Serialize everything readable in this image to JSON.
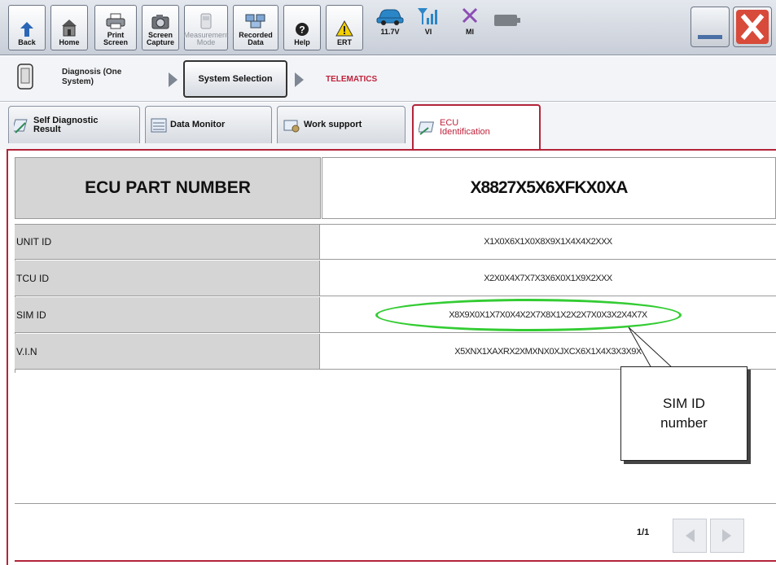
{
  "toolbar": {
    "back": "Back",
    "home": "Home",
    "print_screen": "Print Screen",
    "screen_capture": "Screen\nCapture",
    "measurement_mode": "Measurement\nMode",
    "recorded_data": "Recorded\nData",
    "help": "Help",
    "ert": "ERT",
    "battery_voltage": "11.7V",
    "vi": "VI",
    "mi": "MI"
  },
  "breadcrumb": {
    "diagnosis": "Diagnosis (One\nSystem)",
    "system_selection": "System Selection",
    "current": "TELEMATICS"
  },
  "tabs": {
    "self_diagnostic": "Self Diagnostic\nResult",
    "data_monitor": "Data Monitor",
    "work_support": "Work support",
    "ecu_identification": "ECU\nIdentification"
  },
  "table": {
    "header_label": "ECU PART NUMBER",
    "header_value": "X8827X5X6XFKX0XA",
    "rows": [
      {
        "label": "UNIT ID",
        "value": "X1X0X6X1X0X8X9X1X4X4X2XXX"
      },
      {
        "label": "TCU ID",
        "value": "X2X0X4X7X7X3X6X0X1X9X2XXX"
      },
      {
        "label": "SIM ID",
        "value": "X8X9X0X1X7X0X4X2X7X8X1X2X2X7X0X3X2X4X7X"
      },
      {
        "label": "V.I.N",
        "value": "X5XNX1XAXRX2XMXNX0XJXCX6X1X4X3X3X9X"
      }
    ]
  },
  "pagination": {
    "page": "1/1"
  },
  "annotation": {
    "callout": "SIM ID\nnumber"
  },
  "colors": {
    "accent": "#b3243a",
    "highlight": "#33cc33"
  }
}
